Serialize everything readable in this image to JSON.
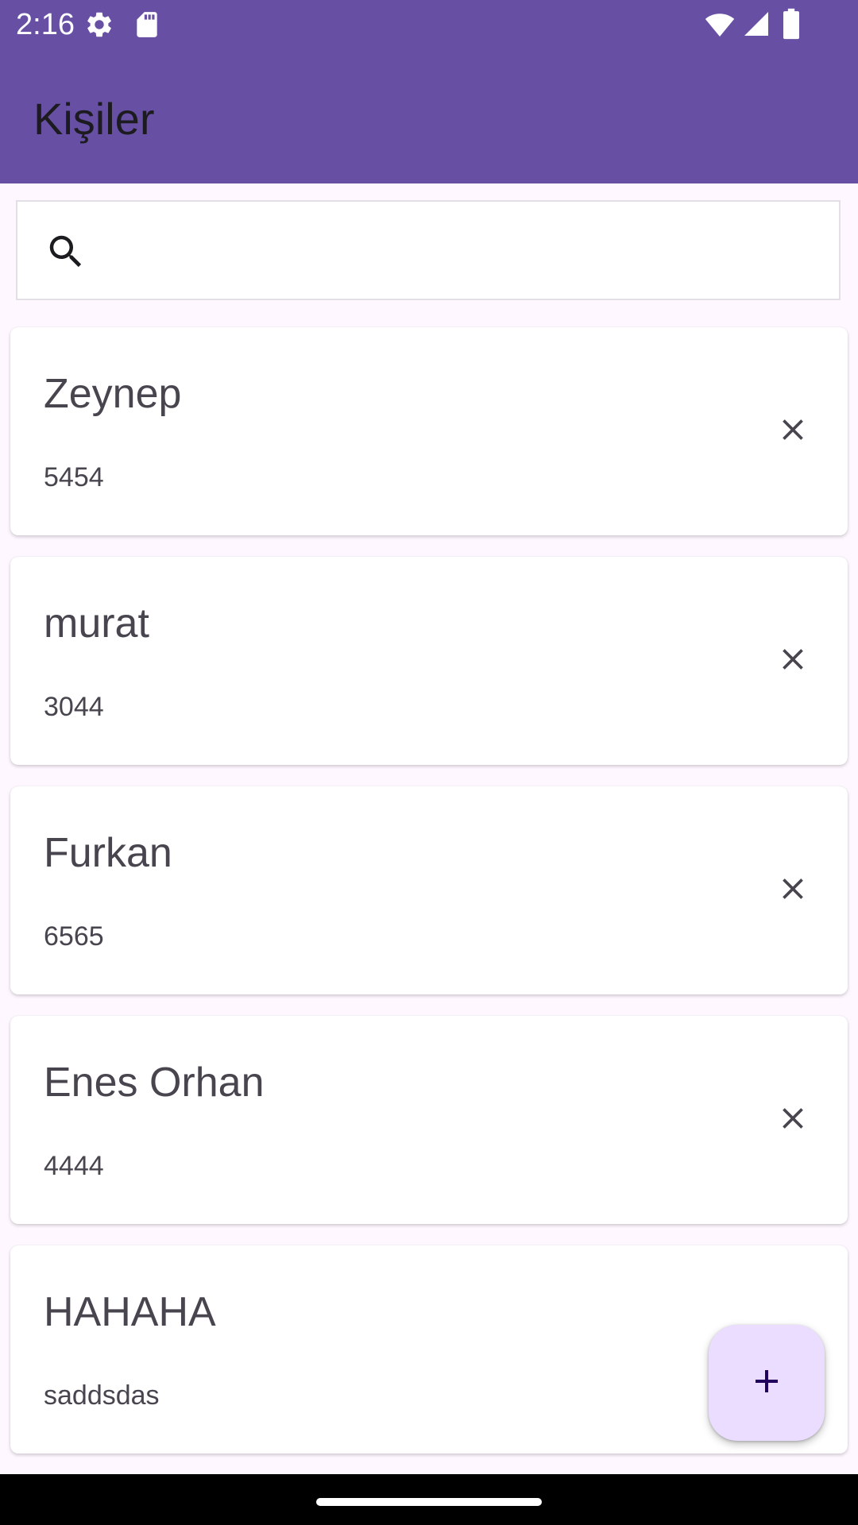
{
  "colors": {
    "primary": "#6750A4",
    "background": "#FEF7FF",
    "card": "#FFFFFF",
    "fab": "#EADDFF",
    "on_fab": "#21005D",
    "text": "#49454F"
  },
  "status_bar": {
    "time": "2:16",
    "left_icons": [
      "gear-icon",
      "sd-card-icon"
    ],
    "right_icons": [
      "wifi-icon",
      "signal-icon",
      "battery-icon"
    ]
  },
  "app_bar": {
    "title": "Kişiler"
  },
  "search": {
    "icon": "search-icon",
    "value": "",
    "placeholder": ""
  },
  "contacts": [
    {
      "name": "Zeynep",
      "number": "5454"
    },
    {
      "name": "murat",
      "number": "3044"
    },
    {
      "name": "Furkan",
      "number": "6565"
    },
    {
      "name": "Enes Orhan",
      "number": "4444"
    },
    {
      "name": "HAHAHA",
      "number": "saddsdas"
    }
  ],
  "fab": {
    "icon": "plus-icon"
  }
}
